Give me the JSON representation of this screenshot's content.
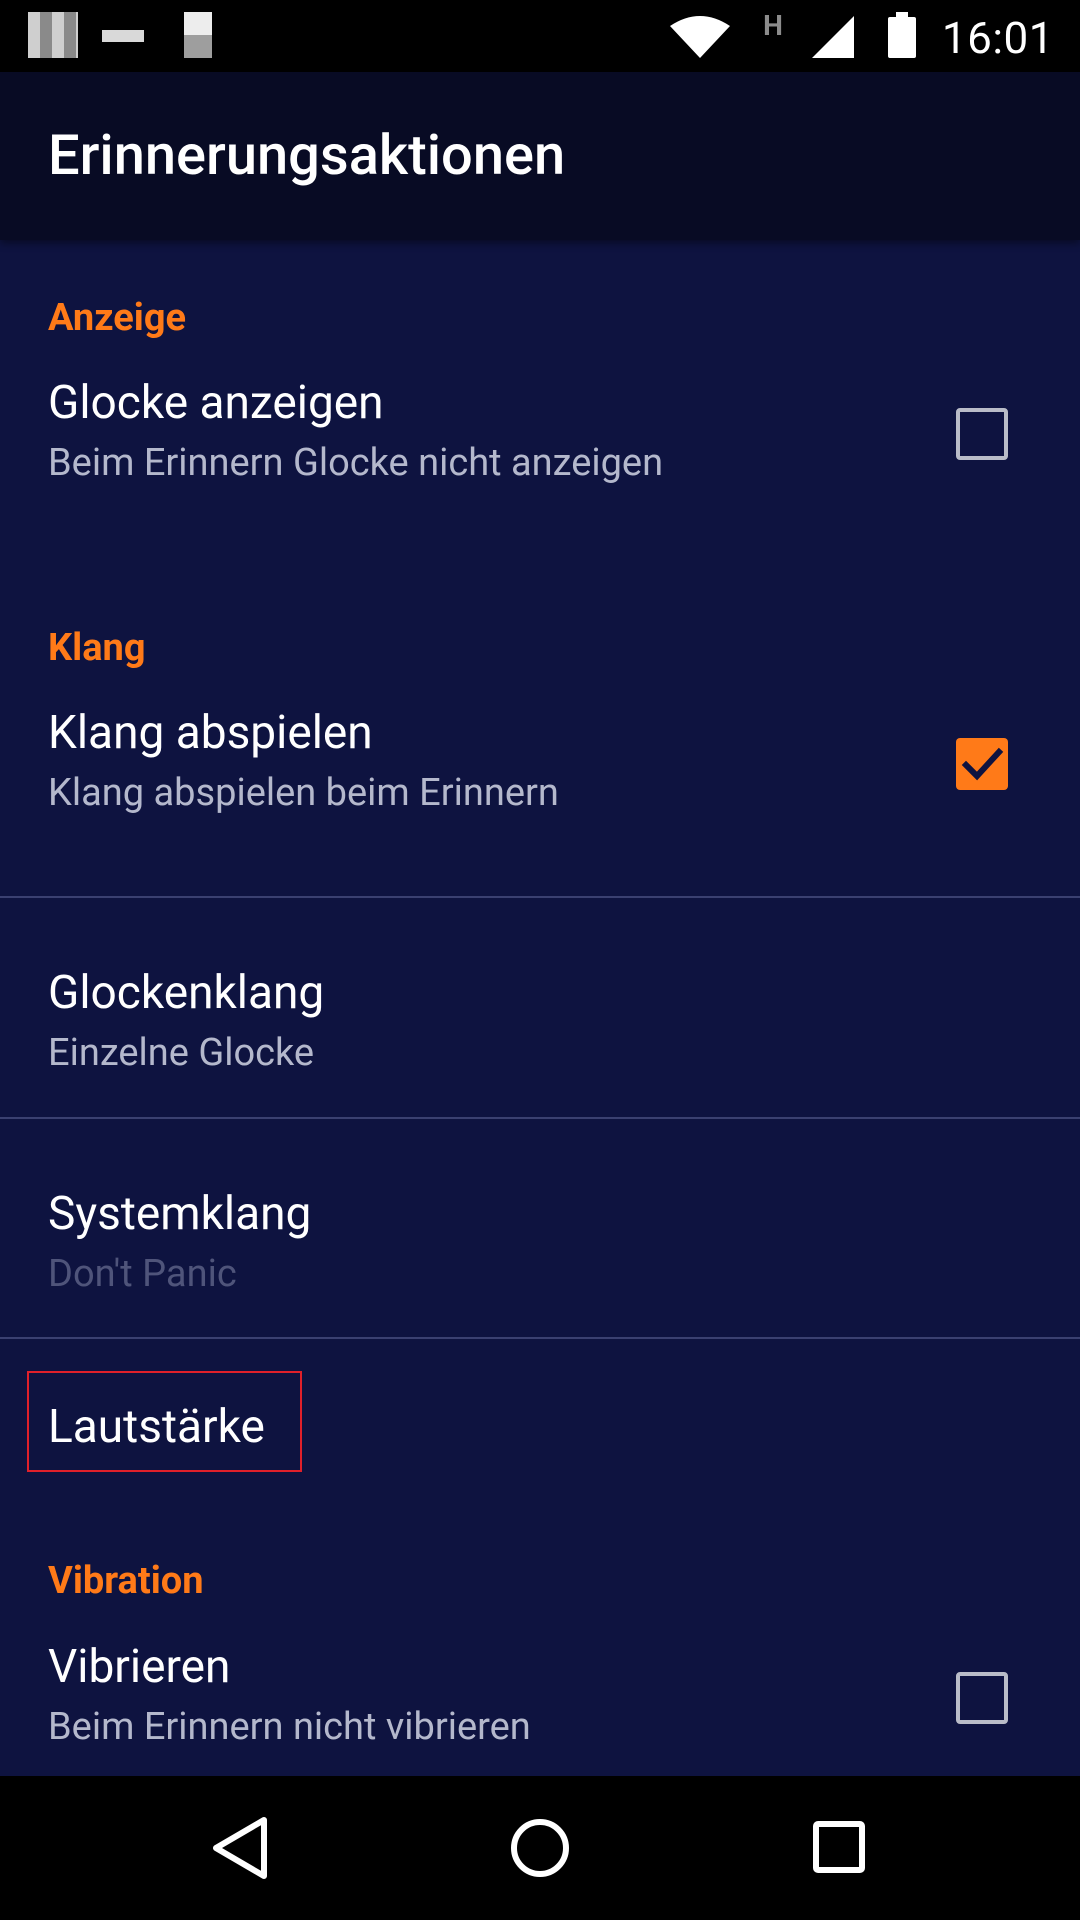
{
  "status_bar": {
    "time": "16:01",
    "network_type": "H",
    "icons": [
      "notification-icon",
      "notification-icon",
      "notification-icon",
      "wifi-icon",
      "h-network-icon",
      "signal-icon",
      "battery-icon"
    ]
  },
  "app_bar": {
    "title": "Erinnerungsaktionen"
  },
  "colors": {
    "accent": "#ff7a18",
    "background": "#0e1340",
    "app_bar": "#080b24",
    "highlight": "#e0202a"
  },
  "sections": {
    "display": {
      "header": "Anzeige",
      "show_bell": {
        "title": "Glocke anzeigen",
        "summary": "Beim Erinnern Glocke nicht anzeigen",
        "checked": false
      }
    },
    "sound": {
      "header": "Klang",
      "play_sound": {
        "title": "Klang abspielen",
        "summary": "Klang abspielen beim Erinnern",
        "checked": true
      },
      "bell_sound": {
        "title": "Glockenklang",
        "summary": "Einzelne Glocke"
      },
      "system_sound": {
        "title": "Systemklang",
        "summary": "Don't Panic",
        "enabled": false
      },
      "volume": {
        "title": "Lautstärke"
      }
    },
    "vibration": {
      "header": "Vibration",
      "vibrate": {
        "title": "Vibrieren",
        "summary": "Beim Erinnern nicht vibrieren",
        "checked": false
      }
    }
  },
  "nav_bar": {
    "buttons": [
      "back-icon",
      "home-icon",
      "recents-icon"
    ]
  }
}
